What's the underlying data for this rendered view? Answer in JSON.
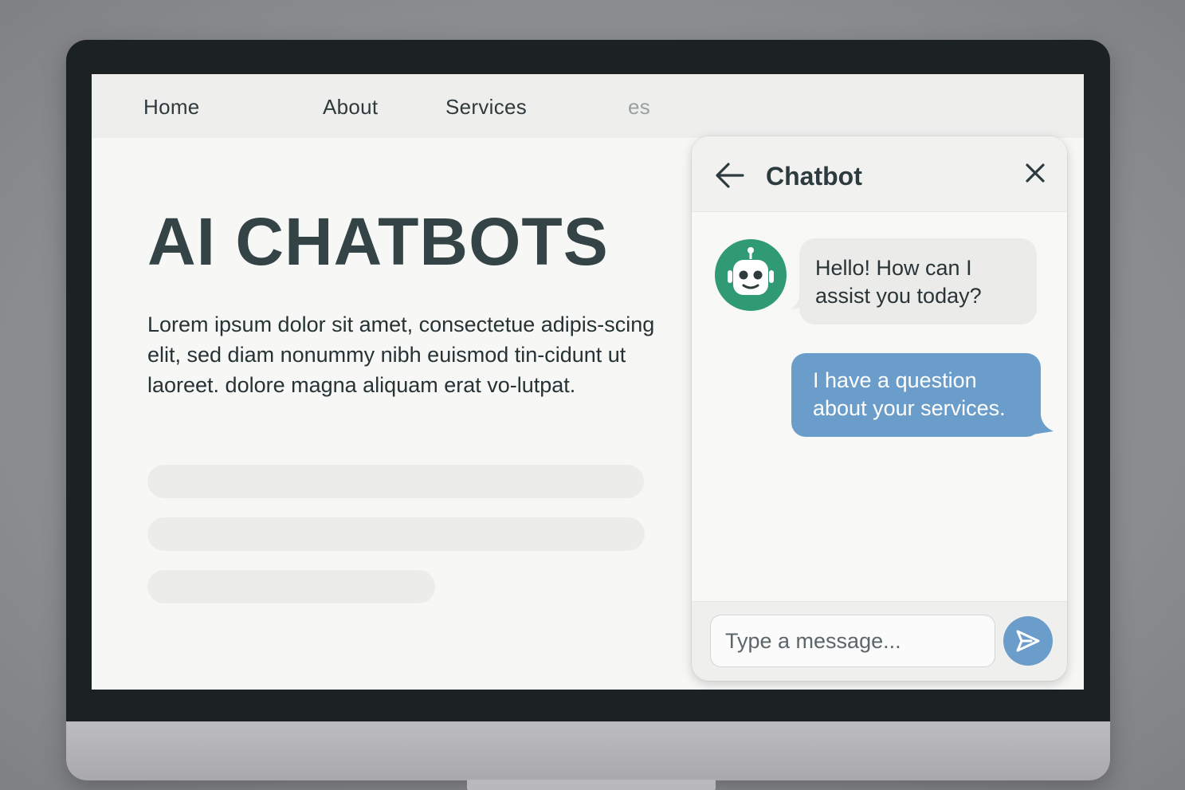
{
  "nav": {
    "items": [
      {
        "label": "Home"
      },
      {
        "label": "About"
      },
      {
        "label": "Services"
      },
      {
        "label": "es"
      }
    ]
  },
  "hero": {
    "title": "AI CHATBOTS",
    "body": "Lorem ipsum dolor sit amet, consectetue adipis-scing elit, sed diam nonummy nibh euismod tin-cidunt ut laoreet. dolore magna aliquam erat vo-lutpat."
  },
  "chat": {
    "title": "Chatbot",
    "back_icon": "arrow-left-icon",
    "close_icon": "close-icon",
    "avatar_icon": "robot-icon",
    "messages": [
      {
        "from": "bot",
        "text": "Hello! How can I assist you today?"
      },
      {
        "from": "user",
        "text": "I have a question about your services."
      }
    ],
    "input": {
      "placeholder": "Type a message..."
    },
    "send_icon": "send-icon"
  },
  "colors": {
    "accent": "#6b9dca",
    "avatar": "#2f9a73",
    "title_text": "#344446"
  }
}
